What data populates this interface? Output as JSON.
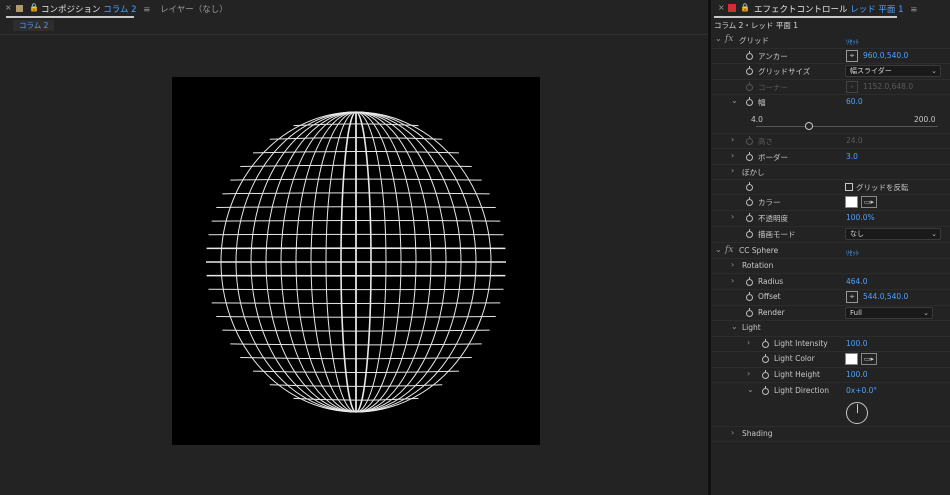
{
  "composition_panel": {
    "close_glyph": "×",
    "tab_prefix": "コンポジション",
    "tab_name": "コラム 2",
    "menu_glyph": "≡",
    "layer_tab": "レイヤー（なし）",
    "subtab": "コラム 2",
    "comp_swatch_color": "#b09a6a"
  },
  "effect_panel": {
    "close_glyph": "×",
    "tab_prefix": "エフェクトコントロール",
    "tab_layer": "レッド 平面 1",
    "menu_glyph": "≡",
    "swatch_color": "#d03030",
    "header": "コラム 2・レッド 平面 1",
    "grid": {
      "name": "グリッド",
      "reset": "ﾘｾｯﾄ",
      "anchor_label": "アンカー",
      "anchor_value": "960.0,540.0",
      "size_label": "グリッドサイズ",
      "size_value": "幅スライダー",
      "corner_label": "コーナー",
      "corner_value": "1152.0,648.0",
      "width_label": "幅",
      "width_value": "60.0",
      "width_min": "4.0",
      "width_max": "200.0",
      "width_slider_fraction": 0.29,
      "height_label": "高さ",
      "height_value": "24.0",
      "border_label": "ボーダー",
      "border_value": "3.0",
      "feather_label": "ぼかし",
      "invert_label": "グリッドを反転",
      "color_label": "カラー",
      "color_value": "#ffffff",
      "opacity_label": "不透明度",
      "opacity_value": "100.0%",
      "blend_label": "描画モード",
      "blend_value": "なし"
    },
    "cc_sphere": {
      "name": "CC Sphere",
      "reset": "ﾘｾｯﾄ",
      "rotation_label": "Rotation",
      "radius_label": "Radius",
      "radius_value": "464.0",
      "offset_label": "Offset",
      "offset_value": "544.0,540.0",
      "render_label": "Render",
      "render_value": "Full",
      "light_label": "Light",
      "light_intensity_label": "Light Intensity",
      "light_intensity_value": "100.0",
      "light_color_label": "Light Color",
      "light_color_value": "#ffffff",
      "light_height_label": "Light Height",
      "light_height_value": "100.0",
      "light_direction_label": "Light Direction",
      "light_direction_value": "0x+0.0°",
      "shading_label": "Shading"
    }
  }
}
